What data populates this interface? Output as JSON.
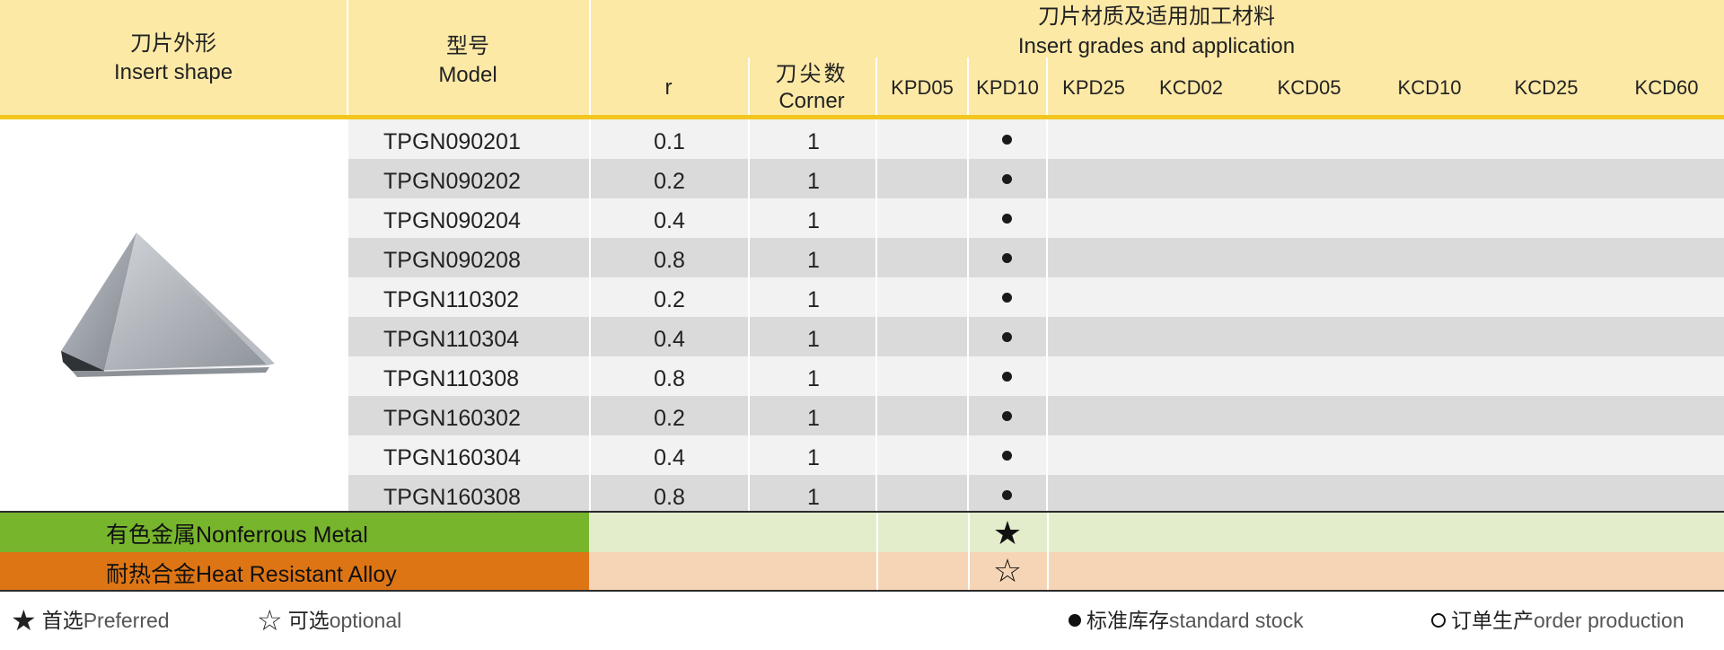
{
  "header": {
    "shape_cn": "刀片外形",
    "shape_en": "Insert shape",
    "model_cn": "型号",
    "model_en": "Model",
    "grades_cn": "刀片材质及适用加工材料",
    "grades_en": "Insert grades and application",
    "r": "r",
    "corner_cn": "刀尖数",
    "corner_en": "Corner",
    "grades": [
      "KPD05",
      "KPD10",
      "KPD25",
      "KCD02",
      "KCD05",
      "KCD10",
      "KCD25",
      "KCD60"
    ]
  },
  "shape_image": "triangle-insert-icon",
  "rows": [
    {
      "model": "TPGN090201",
      "r": "0.1",
      "corner": "1",
      "stock": "KPD10"
    },
    {
      "model": "TPGN090202",
      "r": "0.2",
      "corner": "1",
      "stock": "KPD10"
    },
    {
      "model": "TPGN090204",
      "r": "0.4",
      "corner": "1",
      "stock": "KPD10"
    },
    {
      "model": "TPGN090208",
      "r": "0.8",
      "corner": "1",
      "stock": "KPD10"
    },
    {
      "model": "TPGN110302",
      "r": "0.2",
      "corner": "1",
      "stock": "KPD10"
    },
    {
      "model": "TPGN110304",
      "r": "0.4",
      "corner": "1",
      "stock": "KPD10"
    },
    {
      "model": "TPGN110308",
      "r": "0.8",
      "corner": "1",
      "stock": "KPD10"
    },
    {
      "model": "TPGN160302",
      "r": "0.2",
      "corner": "1",
      "stock": "KPD10"
    },
    {
      "model": "TPGN160304",
      "r": "0.4",
      "corner": "1",
      "stock": "KPD10"
    },
    {
      "model": "TPGN160308",
      "r": "0.8",
      "corner": "1",
      "stock": "KPD10"
    }
  ],
  "applications": [
    {
      "label": "有色金属Nonferrous Metal",
      "symbol": "★",
      "rating": "preferred",
      "grade": "KPD10",
      "label_color": "#77b52d",
      "row_color": "#e3edcc"
    },
    {
      "label": "耐热合金Heat Resistant Alloy",
      "symbol": "☆",
      "rating": "optional",
      "grade": "KPD10",
      "label_color": "#de7515",
      "row_color": "#f6d5b7"
    }
  ],
  "legend": {
    "preferred_symbol": "★",
    "preferred_cn": "首选",
    "preferred_en": "Preferred",
    "optional_symbol": "☆",
    "optional_cn": "可选",
    "optional_en": "optional",
    "stock_cn": "标准库存",
    "stock_en": "standard stock",
    "order_cn": "订单生产",
    "order_en": "order production"
  },
  "colors": {
    "header_bg": "#fde9a6",
    "header_line": "#f2c61f",
    "row_light": "#f2f2f2",
    "row_dark": "#dadada"
  }
}
